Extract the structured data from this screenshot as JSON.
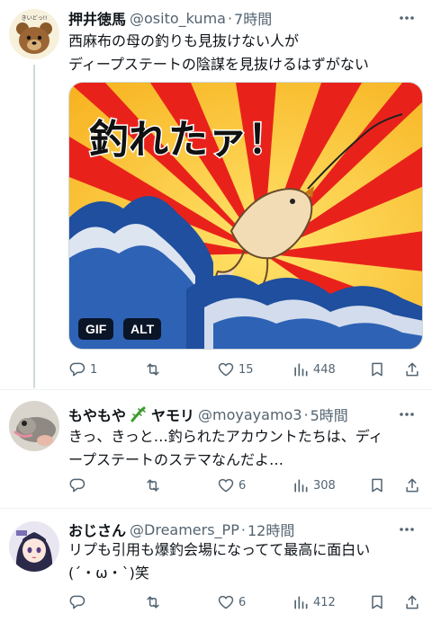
{
  "tweets": [
    {
      "name": "押井徳馬",
      "handle": "@osito_kuma",
      "time": "7時間",
      "lines": [
        "西麻布の母の釣りも見抜けない人が",
        "ディープステートの陰謀を見抜けるはずがない"
      ],
      "media": {
        "caption_text": "釣れたァ！",
        "gif_badge": "GIF",
        "alt_badge": "ALT"
      },
      "avatar_text": "きいどっ!!",
      "replies": "1",
      "reposts": "",
      "likes": "15",
      "views": "448"
    },
    {
      "name": "もやもや",
      "name_suffix": "ヤモリ",
      "handle": "@moyayamo3",
      "time": "5時間",
      "lines": [
        "きっ、きっと…釣られたアカウントたちは、ディ",
        "ープステートのステマなんだよ…"
      ],
      "replies": "",
      "reposts": "",
      "likes": "6",
      "views": "308"
    },
    {
      "name": "おじさん",
      "handle": "@Dreamers_PP",
      "time": "12時間",
      "lines": [
        "リプも引用も爆釣会場になってて最高に面白い",
        "(´・ω・`)笑"
      ],
      "replies": "",
      "reposts": "",
      "likes": "6",
      "views": "412"
    }
  ],
  "separator": "·",
  "icons": {
    "reply": "reply-icon",
    "repost": "repost-icon",
    "like": "heart-icon",
    "views": "views-icon",
    "bookmark": "bookmark-icon",
    "share": "share-icon",
    "more": "more-icon",
    "gecko": "gecko-emoji-icon"
  },
  "colors": {
    "text": "#0f1419",
    "secondary": "#536471",
    "divider": "#eff3f4",
    "thread_line": "#cfd9de"
  }
}
